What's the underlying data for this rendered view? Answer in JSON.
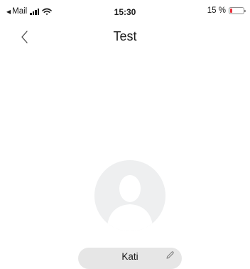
{
  "status_bar": {
    "back_app": "Mail",
    "time": "15:30",
    "battery_percent_label": "15 %",
    "battery_level": 0.15,
    "battery_color": "#e8333d",
    "icons": [
      "back-triangle-icon",
      "signal-icon",
      "wifi-icon",
      "battery-icon"
    ]
  },
  "nav": {
    "back_icon": "chevron-left-icon",
    "title": "Test"
  },
  "profile": {
    "avatar_icon": "person-placeholder-icon",
    "name": "Kati",
    "edit_icon": "pencil-icon"
  }
}
